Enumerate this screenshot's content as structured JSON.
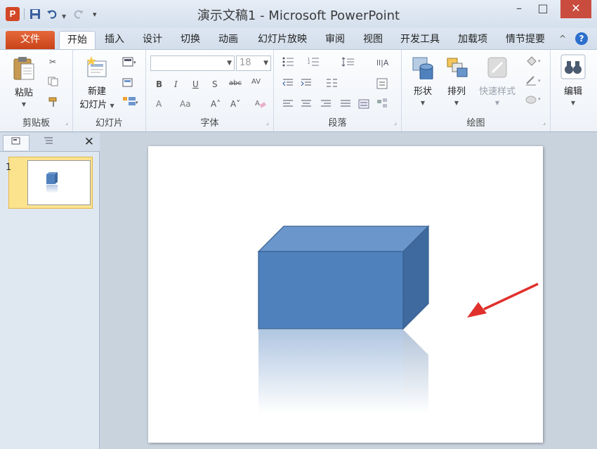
{
  "window": {
    "title": "演示文稿1 - Microsoft PowerPoint",
    "app_icon": "P"
  },
  "quick_access": {
    "save_icon": "save-icon",
    "undo_icon": "undo-icon",
    "redo_icon": "redo-icon",
    "customize_icon": "customize-icon"
  },
  "tabs": [
    {
      "label": "文件"
    },
    {
      "label": "开始"
    },
    {
      "label": "插入"
    },
    {
      "label": "设计"
    },
    {
      "label": "切换"
    },
    {
      "label": "动画"
    },
    {
      "label": "幻灯片放映"
    },
    {
      "label": "审阅"
    },
    {
      "label": "视图"
    },
    {
      "label": "开发工具"
    },
    {
      "label": "加载项"
    },
    {
      "label": "情节提要"
    }
  ],
  "ribbon": {
    "clipboard": {
      "label": "剪贴板",
      "paste": "粘贴"
    },
    "slides": {
      "label": "幻灯片",
      "new_slide_line1": "新建",
      "new_slide_line2": "幻灯片"
    },
    "font": {
      "label": "字体",
      "font_name": "",
      "font_size": "18"
    },
    "paragraph": {
      "label": "段落"
    },
    "drawing": {
      "label": "绘图",
      "shapes": "形状",
      "arrange": "排列",
      "quick_styles": "快速样式"
    },
    "editing": {
      "label": "编辑"
    }
  },
  "slide_panel": {
    "slide_number": "1"
  },
  "colors": {
    "cube_front": "#4f81bd",
    "cube_top": "#6b96cc",
    "cube_side": "#3f6a9f",
    "cube_edge": "#38608f",
    "arrow": "#e0302c",
    "file_tab": "#d9542a"
  }
}
